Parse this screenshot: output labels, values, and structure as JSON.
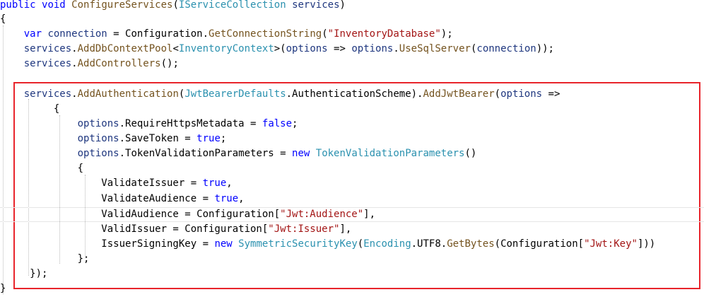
{
  "editor": {
    "lines": [
      {
        "tokens": [
          [
            "kw",
            "public"
          ],
          [
            "pl",
            " "
          ],
          [
            "kw",
            "void"
          ],
          [
            "pl",
            " "
          ],
          [
            "me",
            "ConfigureServices"
          ],
          [
            "pl",
            "("
          ],
          [
            "ty",
            "IServiceCollection"
          ],
          [
            "pl",
            " "
          ],
          [
            "va",
            "services"
          ],
          [
            "pl",
            ")"
          ]
        ]
      },
      {
        "tokens": [
          [
            "pl",
            "{"
          ]
        ]
      },
      {
        "tokens": [
          [
            "pl",
            "    "
          ],
          [
            "kw",
            "var"
          ],
          [
            "pl",
            " "
          ],
          [
            "va",
            "connection"
          ],
          [
            "pl",
            " = Configuration."
          ],
          [
            "me",
            "GetConnectionString"
          ],
          [
            "pl",
            "("
          ],
          [
            "st",
            "\"InventoryDatabase\""
          ],
          [
            "pl",
            ");"
          ]
        ]
      },
      {
        "tokens": [
          [
            "pl",
            "    "
          ],
          [
            "va",
            "services"
          ],
          [
            "pl",
            "."
          ],
          [
            "me",
            "AddDbContextPool"
          ],
          [
            "pl",
            "<"
          ],
          [
            "ty",
            "InventoryContext"
          ],
          [
            "pl",
            ">("
          ],
          [
            "va",
            "options"
          ],
          [
            "pl",
            " => "
          ],
          [
            "va",
            "options"
          ],
          [
            "pl",
            "."
          ],
          [
            "me",
            "UseSqlServer"
          ],
          [
            "pl",
            "("
          ],
          [
            "va",
            "connection"
          ],
          [
            "pl",
            "));"
          ]
        ]
      },
      {
        "tokens": [
          [
            "pl",
            "    "
          ],
          [
            "va",
            "services"
          ],
          [
            "pl",
            "."
          ],
          [
            "me",
            "AddControllers"
          ],
          [
            "pl",
            "();"
          ]
        ]
      },
      {
        "tokens": []
      },
      {
        "tokens": [
          [
            "pl",
            "    "
          ],
          [
            "va",
            "services"
          ],
          [
            "pl",
            "."
          ],
          [
            "me",
            "AddAuthentication"
          ],
          [
            "pl",
            "("
          ],
          [
            "ty",
            "JwtBearerDefaults"
          ],
          [
            "pl",
            ".AuthenticationScheme)."
          ],
          [
            "me",
            "AddJwtBearer"
          ],
          [
            "pl",
            "("
          ],
          [
            "va",
            "options"
          ],
          [
            "pl",
            " =>"
          ]
        ]
      },
      {
        "tokens": [
          [
            "pl",
            "         {"
          ]
        ]
      },
      {
        "tokens": [
          [
            "pl",
            "             "
          ],
          [
            "va",
            "options"
          ],
          [
            "pl",
            ".RequireHttpsMetadata = "
          ],
          [
            "kw",
            "false"
          ],
          [
            "pl",
            ";"
          ]
        ]
      },
      {
        "tokens": [
          [
            "pl",
            "             "
          ],
          [
            "va",
            "options"
          ],
          [
            "pl",
            ".SaveToken = "
          ],
          [
            "kw",
            "true"
          ],
          [
            "pl",
            ";"
          ]
        ]
      },
      {
        "tokens": [
          [
            "pl",
            "             "
          ],
          [
            "va",
            "options"
          ],
          [
            "pl",
            ".TokenValidationParameters = "
          ],
          [
            "kw",
            "new"
          ],
          [
            "pl",
            " "
          ],
          [
            "ty",
            "TokenValidationParameters"
          ],
          [
            "pl",
            "()"
          ]
        ]
      },
      {
        "tokens": [
          [
            "pl",
            "             {"
          ]
        ]
      },
      {
        "tokens": [
          [
            "pl",
            "                 ValidateIssuer = "
          ],
          [
            "kw",
            "true"
          ],
          [
            "pl",
            ","
          ]
        ]
      },
      {
        "tokens": [
          [
            "pl",
            "                 ValidateAudience = "
          ],
          [
            "kw",
            "true"
          ],
          [
            "pl",
            ","
          ]
        ]
      },
      {
        "tokens": [
          [
            "pl",
            "                 ValidAudience = Configuration["
          ],
          [
            "st",
            "\"Jwt:Audience\""
          ],
          [
            "pl",
            "],"
          ]
        ]
      },
      {
        "tokens": [
          [
            "pl",
            "                 ValidIssuer = Configuration["
          ],
          [
            "st",
            "\"Jwt:Issuer\""
          ],
          [
            "pl",
            "],"
          ]
        ]
      },
      {
        "tokens": [
          [
            "pl",
            "                 IssuerSigningKey = "
          ],
          [
            "kw",
            "new"
          ],
          [
            "pl",
            " "
          ],
          [
            "ty",
            "SymmetricSecurityKey"
          ],
          [
            "pl",
            "("
          ],
          [
            "ty",
            "Encoding"
          ],
          [
            "pl",
            ".UTF8."
          ],
          [
            "me",
            "GetBytes"
          ],
          [
            "pl",
            "(Configuration["
          ],
          [
            "st",
            "\"Jwt:Key\""
          ],
          [
            "pl",
            "]))"
          ]
        ]
      },
      {
        "tokens": [
          [
            "pl",
            "             };"
          ]
        ]
      },
      {
        "tokens": [
          [
            "pl",
            "     });"
          ]
        ]
      },
      {
        "tokens": [
          [
            "pl",
            "}"
          ]
        ]
      }
    ]
  }
}
